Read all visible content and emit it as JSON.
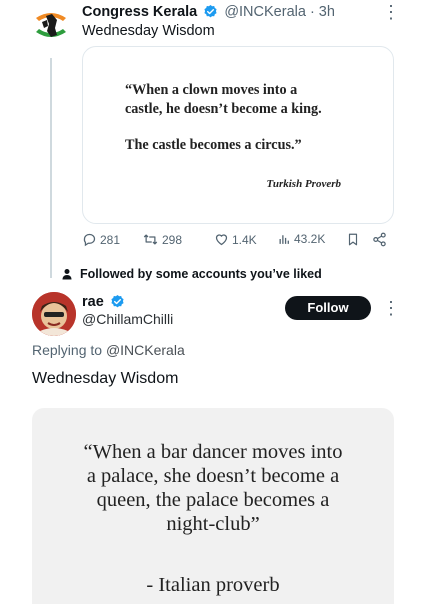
{
  "tweet1": {
    "author_name": "Congress Kerala",
    "handle_time": "@INCKerala · 3h",
    "text": "Wednesday Wisdom",
    "more": "⋮",
    "image_quote": {
      "line1": "“When a clown moves into a",
      "line2": "castle, he doesn’t become a king.",
      "line3": "The castle becomes a circus.”",
      "attribution": "Turkish Proverb"
    },
    "actions": {
      "replies": "281",
      "reposts": "298",
      "likes": "1.4K",
      "views": "43.2K"
    }
  },
  "social_context": "Followed by some accounts you’ve liked",
  "tweet2": {
    "author_name": "rae",
    "handle": "@ChillamChilli",
    "follow_label": "Follow",
    "more": "⋮",
    "replying_prefix": "Replying to ",
    "replying_handle": "@INCKerala",
    "text": "Wednesday Wisdom",
    "image_quote": {
      "line1": "“When a bar dancer moves into",
      "line2": "a palace, she doesn’t become a",
      "line3": "queen, the palace becomes a",
      "line4": "night-club”",
      "attribution": "- Italian proverb"
    }
  },
  "colors": {
    "verified_blue": "#1d9bf0",
    "muted_text": "#536471",
    "follow_button_bg": "#0f1419",
    "congress_orange": "#f08a24",
    "congress_green": "#2e9d3e"
  },
  "icons": [
    "congress-logo-icon",
    "verified-badge-icon",
    "reply-icon",
    "repost-icon",
    "like-icon",
    "views-icon",
    "bookmark-icon",
    "share-icon",
    "person-icon",
    "more-icon"
  ]
}
